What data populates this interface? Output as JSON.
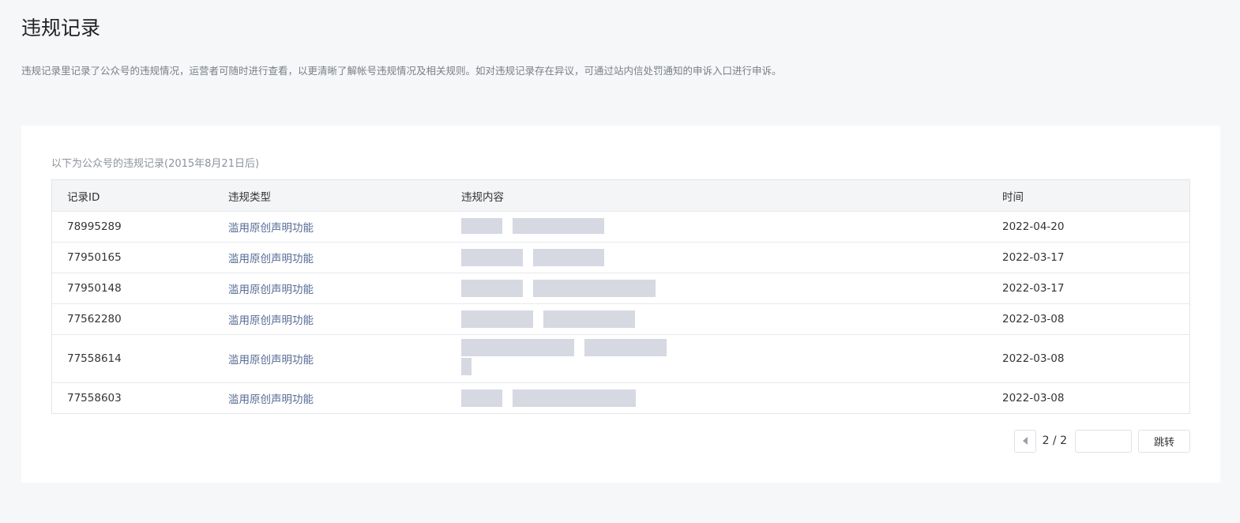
{
  "page": {
    "title": "违规记录",
    "description": "违规记录里记录了公众号的违规情况，运营者可随时进行查看，以更清晰了解帐号违规情况及相关规则。如对违规记录存在异议，可通过站内信处罚通知的申诉入口进行申诉。"
  },
  "records": {
    "caption": "以下为公众号的违规记录(2015年8月21日后)",
    "columns": {
      "id": "记录ID",
      "type": "违规类型",
      "content": "违规内容",
      "time": "时间"
    },
    "rows": [
      {
        "id": "78995289",
        "type": "滥用原创声明功能",
        "time": "2022-04-20"
      },
      {
        "id": "77950165",
        "type": "滥用原创声明功能",
        "time": "2022-03-17"
      },
      {
        "id": "77950148",
        "type": "滥用原创声明功能",
        "time": "2022-03-17"
      },
      {
        "id": "77562280",
        "type": "滥用原创声明功能",
        "time": "2022-03-08"
      },
      {
        "id": "77558614",
        "type": "滥用原创声明功能",
        "time": "2022-03-08"
      },
      {
        "id": "77558603",
        "type": "滥用原创声明功能",
        "time": "2022-03-08"
      }
    ]
  },
  "pagination": {
    "prev_icon": "triangle-left-icon",
    "page_info": "2 / 2",
    "jump_input_value": "",
    "jump_label": "跳转"
  },
  "colors": {
    "link": "#576b95",
    "background": "#f6f7f9"
  }
}
